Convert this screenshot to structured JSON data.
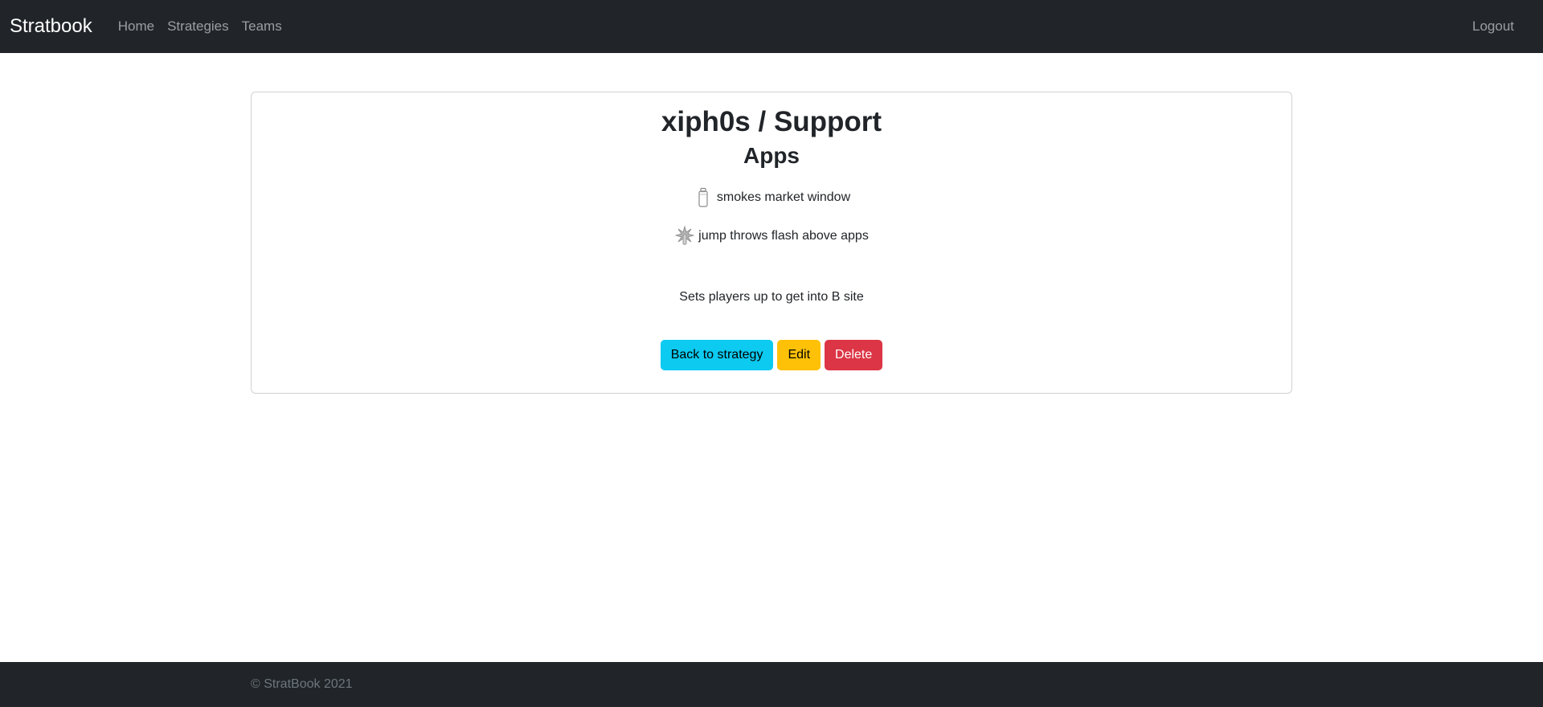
{
  "nav": {
    "brand": "Stratbook",
    "links": [
      "Home",
      "Strategies",
      "Teams"
    ],
    "logout": "Logout"
  },
  "card": {
    "title": "xiph0s / Support",
    "subtitle": "Apps",
    "utilities": [
      {
        "icon": "smoke-grenade-icon",
        "text": "smokes market window"
      },
      {
        "icon": "flashbang-icon",
        "text": "jump throws flash above apps"
      }
    ],
    "description": "Sets players up to get into B site",
    "buttons": {
      "back": "Back to strategy",
      "edit": "Edit",
      "delete": "Delete"
    }
  },
  "footer": {
    "text": "© StratBook 2021"
  },
  "colors": {
    "navbar_bg": "#212529",
    "info": "#0dcaf0",
    "warning": "#ffc107",
    "danger": "#dc3545"
  }
}
